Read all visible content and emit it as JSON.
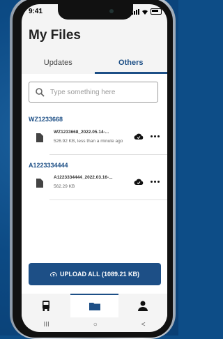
{
  "status": {
    "time": "9:41"
  },
  "page": {
    "title": "My Files"
  },
  "tabs": [
    {
      "label": "Updates",
      "active": false
    },
    {
      "label": "Others",
      "active": true
    }
  ],
  "search": {
    "placeholder": "Type something here"
  },
  "groups": [
    {
      "title": "WZ1233668",
      "files": [
        {
          "name": "WZ1233668_2022.05.14-...",
          "meta": "526.92 KB, less than a minute ago"
        }
      ]
    },
    {
      "title": "A1223334444",
      "files": [
        {
          "name": "A1223334444_2022.03.16-...",
          "meta": "562.29 KB"
        }
      ]
    }
  ],
  "upload": {
    "label": "UPLOAD ALL (1089.21 KB)"
  },
  "nav": {
    "items": [
      "bus-icon",
      "folder-icon",
      "person-icon"
    ],
    "active": "folder-icon"
  },
  "sysbar": {
    "recent": "III",
    "home": "○",
    "back": "<"
  },
  "colors": {
    "primary": "#1d4f86",
    "background": "#0d4d87"
  }
}
